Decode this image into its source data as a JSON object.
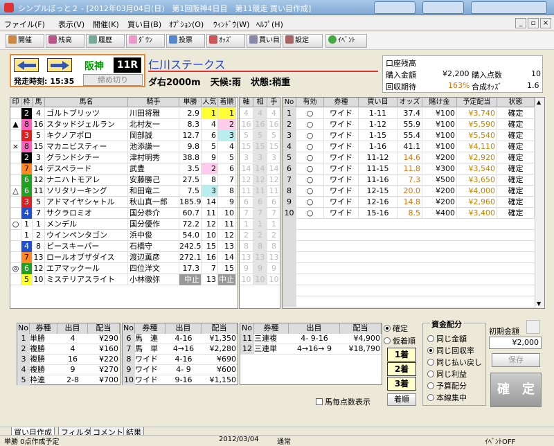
{
  "window": {
    "title": "シンプルぼっと２ - [2012年03月04日(日)　第1回阪神4日目　第11競走 買い目作成]"
  },
  "menu": [
    "ファイル(F)",
    "表示(V)",
    "開催(K)",
    "買い目(B)",
    "ｵﾌﾟｼｮﾝ(O)",
    "ｳｨﾝﾄﾞｳ(W)",
    "ﾍﾙﾌﾟ(H)"
  ],
  "toolbar": [
    "開催",
    "残高",
    "履歴",
    "ﾀﾞｳﾝ",
    "投票",
    "ｵｯｽﾞ",
    "買い目",
    "設定",
    "ｲﾍﾞﾝﾄ"
  ],
  "race": {
    "track": "阪神",
    "number": "11R",
    "start": "発走時刻: 15:35",
    "cutoff": "締め切り",
    "name": "仁川ステークス",
    "course": "ダ右2000m",
    "weather": "天候:雨",
    "going": "状態:稍重"
  },
  "account": {
    "balance_label": "口座残高",
    "buy_label": "購入金額",
    "buy": "¥2,200",
    "count_label": "購入点数",
    "count": "10",
    "rate_label": "回収期待",
    "rate": "163%",
    "odds_label": "合成ｵｯｽﾞ",
    "odds": "1.6"
  },
  "horse_headers": [
    "印",
    "枠",
    "馬",
    "馬名",
    "騎手",
    "単勝",
    "人気",
    "着順"
  ],
  "horses": [
    {
      "mark": "",
      "waku": "2",
      "num": "4",
      "name": "ゴルトブリッツ",
      "jockey": "川田将雅",
      "odds": "2.9",
      "pop": "1",
      "rank": "1",
      "popc": "yell",
      "rankc": "yell"
    },
    {
      "mark": "▲",
      "waku": "8",
      "num": "16",
      "name": "スタッドジェルラン",
      "jockey": "北村友一",
      "odds": "8.3",
      "pop": "4",
      "rank": "2",
      "popc": "",
      "rankc": "pink"
    },
    {
      "mark": "",
      "waku": "3",
      "num": "5",
      "name": "キクノアポロ",
      "jockey": "岡部誠",
      "odds": "12.7",
      "pop": "6",
      "rank": "3",
      "popc": "",
      "rankc": "cyan"
    },
    {
      "mark": "×",
      "waku": "8",
      "num": "15",
      "name": "マカニビスティー",
      "jockey": "池添謙一",
      "odds": "9.8",
      "pop": "5",
      "rank": "4",
      "popc": "",
      "rankc": ""
    },
    {
      "mark": "",
      "waku": "2",
      "num": "3",
      "name": "グランドシチー",
      "jockey": "津村明秀",
      "odds": "38.8",
      "pop": "9",
      "rank": "5",
      "popc": "",
      "rankc": ""
    },
    {
      "mark": "",
      "waku": "7",
      "num": "14",
      "name": "デスペラード",
      "jockey": "武豊",
      "odds": "3.5",
      "pop": "2",
      "rank": "6",
      "popc": "pink",
      "rankc": ""
    },
    {
      "mark": "",
      "waku": "6",
      "num": "12",
      "name": "ナニハトモアレ",
      "jockey": "安藤勝己",
      "odds": "27.5",
      "pop": "8",
      "rank": "7",
      "popc": "",
      "rankc": ""
    },
    {
      "mark": "△",
      "waku": "6",
      "num": "11",
      "name": "ソリタリーキング",
      "jockey": "和田竜二",
      "odds": "7.5",
      "pop": "3",
      "rank": "8",
      "popc": "cyan",
      "rankc": ""
    },
    {
      "mark": "",
      "waku": "3",
      "num": "5",
      "name": "アドマイヤシャトル",
      "jockey": "秋山真一郎",
      "odds": "185.9",
      "pop": "14",
      "rank": "9",
      "popc": "",
      "rankc": ""
    },
    {
      "mark": "",
      "waku": "4",
      "num": "7",
      "name": "サクラロミオ",
      "jockey": "国分恭介",
      "odds": "60.7",
      "pop": "11",
      "rank": "10",
      "popc": "",
      "rankc": ""
    },
    {
      "mark": "○",
      "waku": "1",
      "num": "1",
      "name": "メンデル",
      "jockey": "国分優作",
      "odds": "72.2",
      "pop": "12",
      "rank": "11",
      "popc": "",
      "rankc": ""
    },
    {
      "mark": "",
      "waku": "1",
      "num": "2",
      "name": "ウインペンタゴン",
      "jockey": "浜中俊",
      "odds": "54.0",
      "pop": "10",
      "rank": "12",
      "popc": "",
      "rankc": ""
    },
    {
      "mark": "",
      "waku": "4",
      "num": "8",
      "name": "ピースキーパー",
      "jockey": "石橋守",
      "odds": "242.5",
      "pop": "15",
      "rank": "13",
      "popc": "",
      "rankc": ""
    },
    {
      "mark": "",
      "waku": "7",
      "num": "13",
      "name": "ロールオブザダイス",
      "jockey": "渡辺薫彦",
      "odds": "272.1",
      "pop": "16",
      "rank": "14",
      "popc": "",
      "rankc": ""
    },
    {
      "mark": "◎",
      "waku": "6",
      "num": "12",
      "name": "エアマックール",
      "jockey": "四位洋文",
      "odds": "17.3",
      "pop": "7",
      "rank": "15",
      "popc": "",
      "rankc": ""
    },
    {
      "mark": "",
      "waku": "5",
      "num": "10",
      "name": "ミステリアスライト",
      "jockey": "小林徹弥",
      "odds": "中止",
      "pop": "13",
      "rank": "中止",
      "popc": "",
      "rankc": ""
    }
  ],
  "axis_headers": [
    "軸",
    "相",
    "手"
  ],
  "axis_rows": [
    "4",
    "16",
    "5",
    "15",
    "3",
    "14",
    "12",
    "11",
    "6",
    "7",
    "1",
    "2",
    "8",
    "13",
    "9",
    "10"
  ],
  "bet_headers": [
    "No",
    "有効",
    "券種",
    "買い目",
    "オッズ",
    "賭け金",
    "予定配当",
    "状態"
  ],
  "bets": [
    {
      "no": "1",
      "valid": "○",
      "type": "ワイド",
      "combo": "1-11",
      "odds": "37.4",
      "stake": "¥100",
      "payout": "¥3,740",
      "status": "確定"
    },
    {
      "no": "2",
      "valid": "○",
      "type": "ワイド",
      "combo": "1-12",
      "odds": "55.9",
      "stake": "¥100",
      "payout": "¥5,590",
      "status": "確定"
    },
    {
      "no": "3",
      "valid": "○",
      "type": "ワイド",
      "combo": "1-15",
      "odds": "55.4",
      "stake": "¥100",
      "payout": "¥5,540",
      "status": "確定"
    },
    {
      "no": "4",
      "valid": "○",
      "type": "ワイド",
      "combo": "1-16",
      "odds": "41.1",
      "stake": "¥100",
      "payout": "¥4,110",
      "status": "確定"
    },
    {
      "no": "5",
      "valid": "○",
      "type": "ワイド",
      "combo": "11-12",
      "odds": "14.6",
      "stake": "¥200",
      "payout": "¥2,920",
      "status": "確定"
    },
    {
      "no": "6",
      "valid": "○",
      "type": "ワイド",
      "combo": "11-15",
      "odds": "11.8",
      "stake": "¥300",
      "payout": "¥3,540",
      "status": "確定"
    },
    {
      "no": "7",
      "valid": "○",
      "type": "ワイド",
      "combo": "11-16",
      "odds": "7.3",
      "stake": "¥500",
      "payout": "¥3,650",
      "status": "確定"
    },
    {
      "no": "8",
      "valid": "○",
      "type": "ワイド",
      "combo": "12-15",
      "odds": "20.0",
      "stake": "¥200",
      "payout": "¥4,000",
      "status": "確定"
    },
    {
      "no": "9",
      "valid": "○",
      "type": "ワイド",
      "combo": "12-16",
      "odds": "14.8",
      "stake": "¥200",
      "payout": "¥2,960",
      "status": "確定"
    },
    {
      "no": "10",
      "valid": "○",
      "type": "ワイド",
      "combo": "15-16",
      "odds": "8.5",
      "stake": "¥400",
      "payout": "¥3,400",
      "status": "確定"
    }
  ],
  "pay_headers": [
    "No",
    "券種",
    "出目",
    "配当"
  ],
  "pay1": [
    [
      "1",
      "単勝",
      "4",
      "¥290"
    ],
    [
      "2",
      "複勝",
      "4",
      "¥160"
    ],
    [
      "3",
      "複勝",
      "16",
      "¥220"
    ],
    [
      "4",
      "複勝",
      "9",
      "¥270"
    ],
    [
      "5",
      "枠連",
      "2-8",
      "¥700"
    ]
  ],
  "pay2": [
    [
      "6",
      "馬　連",
      "4-16",
      "¥1,350"
    ],
    [
      "7",
      "馬　単",
      "4→16",
      "¥2,280"
    ],
    [
      "8",
      "ワイド",
      "4-16",
      "¥690"
    ],
    [
      "9",
      "ワイド",
      "4- 9",
      "¥600"
    ],
    [
      "10",
      "ワイド",
      "9-16",
      "¥1,150"
    ]
  ],
  "pay3": [
    [
      "11",
      "三連複",
      "4- 9-16",
      "¥4,900"
    ],
    [
      "12",
      "三連単",
      "4→16→ 9",
      "¥18,790"
    ]
  ],
  "result_opts": {
    "confirmed": "確定",
    "provisional": "仮着順",
    "p1": "1着",
    "p2": "2着",
    "p3": "3着",
    "order": "着順",
    "show_points": "馬毎点数表示"
  },
  "alloc": {
    "title": "資金配分",
    "opts": [
      "同じ金額",
      "同じ回収率",
      "同じ払い戻し",
      "同じ利益",
      "予算配分",
      "本線集中"
    ],
    "initial_label": "初期金額",
    "initial": "¥2,000",
    "save": "保存",
    "confirm": "確　定"
  },
  "tabs": [
    "買い目作成",
    "フィルタ",
    "コメント",
    "結果"
  ],
  "status": {
    "msg": "単勝 0点作成予定",
    "date": "2012/03/04",
    "mode": "通常",
    "event": "ｲﾍﾞﾝﾄOFF"
  },
  "colors": {
    "waku1": "#ffffff",
    "waku2": "#000000",
    "waku3": "#e02020",
    "waku4": "#2050d0",
    "waku5": "#ffff20",
    "waku6": "#20a020",
    "waku7": "#ff8820",
    "waku8": "#ff60c0"
  }
}
